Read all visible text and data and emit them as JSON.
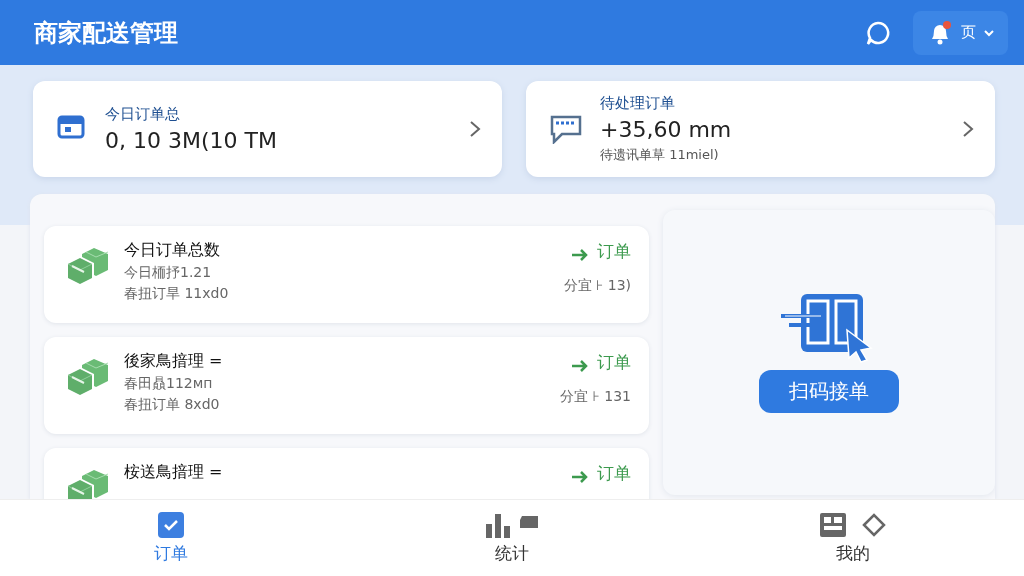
{
  "header": {
    "title": "商家配送管理",
    "user_label": "页",
    "has_notification": true
  },
  "stats": [
    {
      "kind": "calendar",
      "label": "今日订单总",
      "value": "0, 10 3M(10 TM"
    },
    {
      "kind": "chat",
      "label": "待处理订单",
      "value": "+35,60 mm",
      "note": "待遗讯单草 11miel)"
    }
  ],
  "orders": [
    {
      "title": "今日订单总数",
      "lines": [
        "今日栭抒1.21",
        "春扭订旱  11xd0"
      ],
      "action": "订单",
      "meta": "分宜 ⊦ 13)"
    },
    {
      "title": "後家鳥揞理 =",
      "lines": [
        "春田贔112мп",
        "春扭订单  8xd0"
      ],
      "action": "订单",
      "meta": "分宜 ⊦ 131"
    },
    {
      "title": "桉送鳥揞理 =",
      "action": "订单"
    }
  ],
  "scan": {
    "button": "扫码接单"
  },
  "tabs": [
    {
      "kind": "orders",
      "label": "订单",
      "selected": true
    },
    {
      "kind": "stats",
      "label": "统计",
      "selected": false
    },
    {
      "kind": "profile",
      "label": "我的",
      "selected": false
    }
  ]
}
